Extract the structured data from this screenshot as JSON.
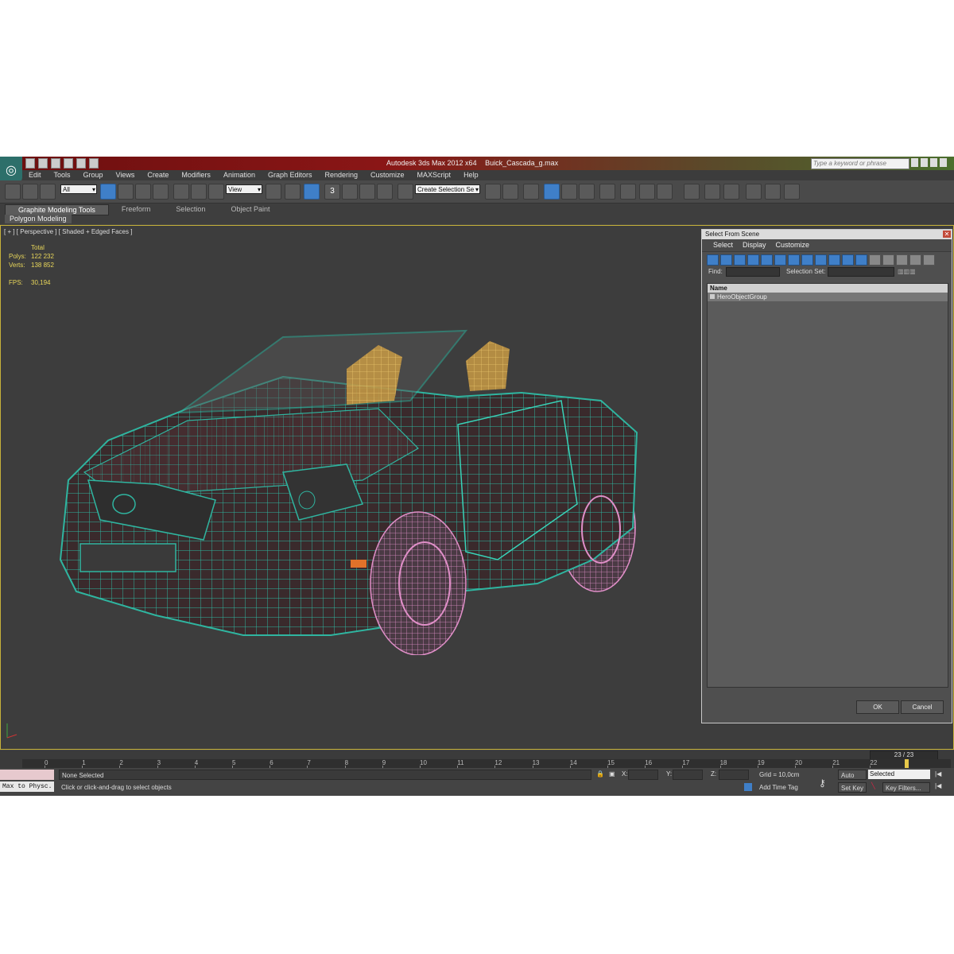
{
  "window": {
    "app_title": "Autodesk 3ds Max  2012 x64",
    "file_name": "Buick_Cascada_g.max",
    "search_placeholder": "Type a keyword or phrase"
  },
  "menu": [
    "Edit",
    "Tools",
    "Group",
    "Views",
    "Create",
    "Modifiers",
    "Animation",
    "Graph Editors",
    "Rendering",
    "Customize",
    "MAXScript",
    "Help"
  ],
  "toolbar": {
    "filter_value": "All",
    "ref_coord_value": "View",
    "selection_set_value": "Create Selection Se",
    "snap_label": "3"
  },
  "ribbon": {
    "tabs": [
      "Graphite Modeling Tools",
      "Freeform",
      "Selection",
      "Object Paint"
    ],
    "sub_label": "Polygon Modeling"
  },
  "viewport": {
    "label": "[ + ] [ Perspective ] [ Shaded + Edged Faces ]",
    "stats": {
      "total_label": "Total",
      "polys_label": "Polys:",
      "polys_value": "122 232",
      "verts_label": "Verts:",
      "verts_value": "138 852",
      "fps_label": "FPS:",
      "fps_value": "30,194"
    }
  },
  "dialog": {
    "title": "Select From Scene",
    "menu": [
      "Select",
      "Display",
      "Customize"
    ],
    "find_label": "Find:",
    "selection_set_label": "Selection Set:",
    "column_name": "Name",
    "items": [
      "HeroObjectGroup"
    ],
    "ok_label": "OK",
    "cancel_label": "Cancel"
  },
  "timeline": {
    "frame_counter": "23 / 23",
    "ticks": [
      "0",
      "1",
      "2",
      "3",
      "4",
      "5",
      "6",
      "7",
      "8",
      "9",
      "10",
      "11",
      "12",
      "13",
      "14",
      "15",
      "16",
      "17",
      "18",
      "19",
      "20",
      "21",
      "22"
    ]
  },
  "status": {
    "selection_text": "None Selected",
    "prompt_text": "Click or click-and-drag to select objects",
    "maxscript_text": "Max to Physc.",
    "x_label": "X:",
    "y_label": "Y:",
    "z_label": "Z:",
    "grid_text": "Grid = 10,0cm",
    "add_time_tag": "Add Time Tag",
    "auto_key": "Auto Key",
    "set_key": "Set Key",
    "selected_value": "Selected",
    "key_filters": "Key Filters..."
  },
  "colors": {
    "wire_body": "#2fb5a0",
    "wire_wheels": "#e08fc8",
    "interior": "#d8a84a",
    "viewport_border": "#c7b23a",
    "stats_text": "#e8d65a"
  }
}
